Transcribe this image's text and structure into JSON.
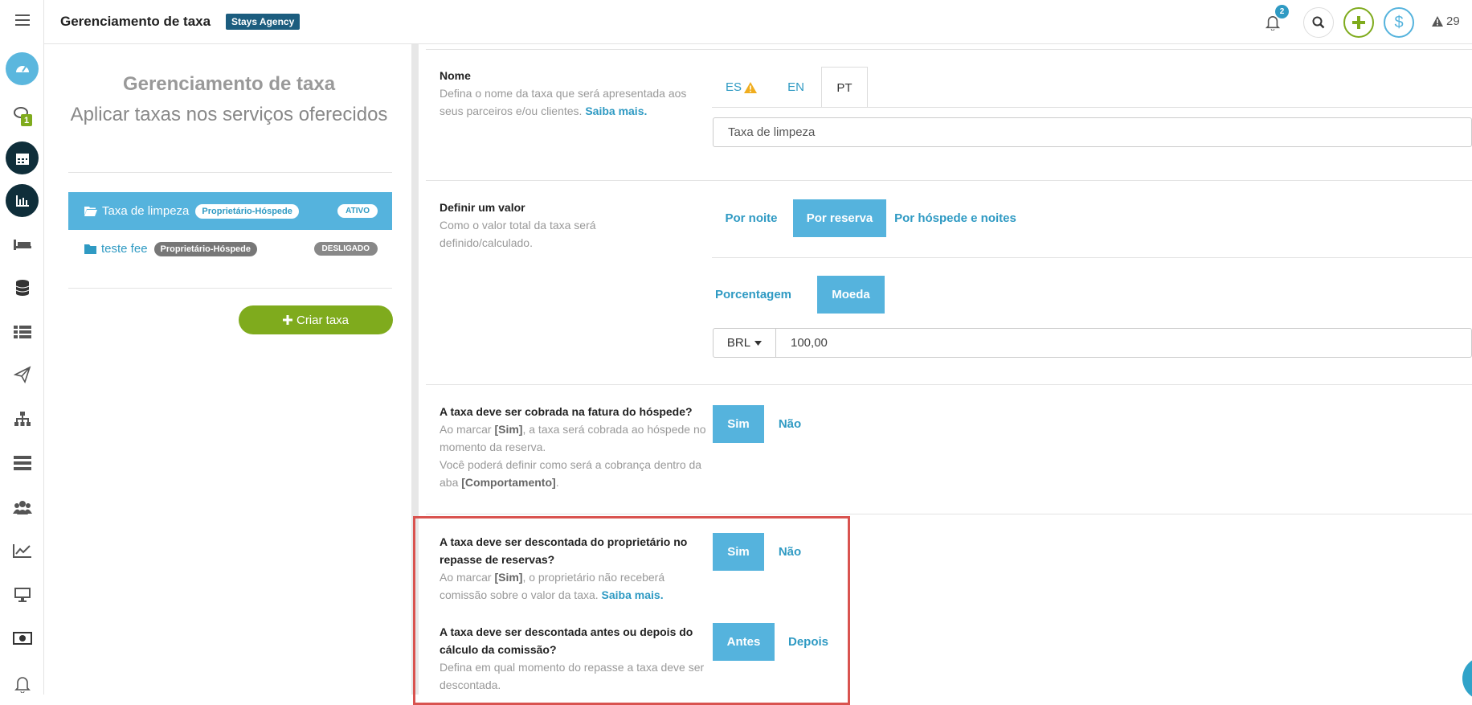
{
  "topbar": {
    "title": "Gerenciamento de taxa",
    "agency_badge": "Stays Agency",
    "notifications_count": "2",
    "alerts_count": "29"
  },
  "sidebar_icons": [
    "menu-icon",
    "dashboard-icon",
    "chat-icon",
    "calendar-icon",
    "bar-chart-icon",
    "bed-icon",
    "database-icon",
    "list-icon",
    "paper-plane-icon",
    "sitemap-icon",
    "server-icon",
    "users-icon",
    "line-chart-icon",
    "monitor-icon",
    "money-icon",
    "bell-icon"
  ],
  "sidebar_chat_badge": "1",
  "left_panel": {
    "heading": "Gerenciamento de taxa",
    "subheading": "Aplicar taxas nos serviços oferecidos",
    "fees": [
      {
        "name": "Taxa de limpeza",
        "tag": "Proprietário-Hóspede",
        "status": "ATIVO"
      },
      {
        "name": "teste fee",
        "tag": "Proprietário-Hóspede",
        "status": "DESLIGADO"
      }
    ],
    "create_button": "Criar taxa"
  },
  "form": {
    "nome": {
      "label": "Nome",
      "help": "Defina o nome da taxa que será apresentada aos seus parceiros e/ou clientes.",
      "help_link": "Saiba mais.",
      "tabs": [
        "ES",
        "EN",
        "PT"
      ],
      "active_tab": "PT",
      "value": "Taxa de limpeza"
    },
    "valor": {
      "label": "Definir um valor",
      "help": "Como o valor total da taxa será definido/calculado.",
      "mode_options": [
        "Por noite",
        "Por reserva",
        "Por hóspede e noites"
      ],
      "mode_selected": "Por reserva",
      "type_options": [
        "Porcentagem",
        "Moeda"
      ],
      "type_selected": "Moeda",
      "currency": "BRL",
      "amount": "100,00"
    },
    "fatura": {
      "label": "A taxa deve ser cobrada na fatura do hóspede?",
      "help_1a": "Ao marcar ",
      "help_1b": "[Sim]",
      "help_1c": ", a taxa será cobrada ao hóspede no momento da reserva.",
      "help_2a": "Você poderá definir como será a cobrança dentro da aba ",
      "help_2b": "[Comportamento]",
      "help_2c": ".",
      "yes": "Sim",
      "no": "Não",
      "selected": "Sim"
    },
    "descontada": {
      "label": "A taxa deve ser descontada do proprietário no repasse de reservas?",
      "help_a": "Ao marcar ",
      "help_b": "[Sim]",
      "help_c": ", o proprietário não receberá comissão sobre o valor da taxa.",
      "help_link": "Saiba mais.",
      "yes": "Sim",
      "no": "Não",
      "selected": "Sim"
    },
    "momento": {
      "label": "A taxa deve ser descontada antes ou depois do cálculo da comissão?",
      "help": "Defina em qual momento do repasse a taxa deve ser descontada.",
      "before": "Antes",
      "after": "Depois",
      "selected": "Antes"
    }
  },
  "colors": {
    "accent": "#55b3dd",
    "link": "#2f9ac3",
    "create_green": "#7fab1d",
    "agency_badge": "#1c5d7f",
    "highlight_red": "#d9534f"
  }
}
